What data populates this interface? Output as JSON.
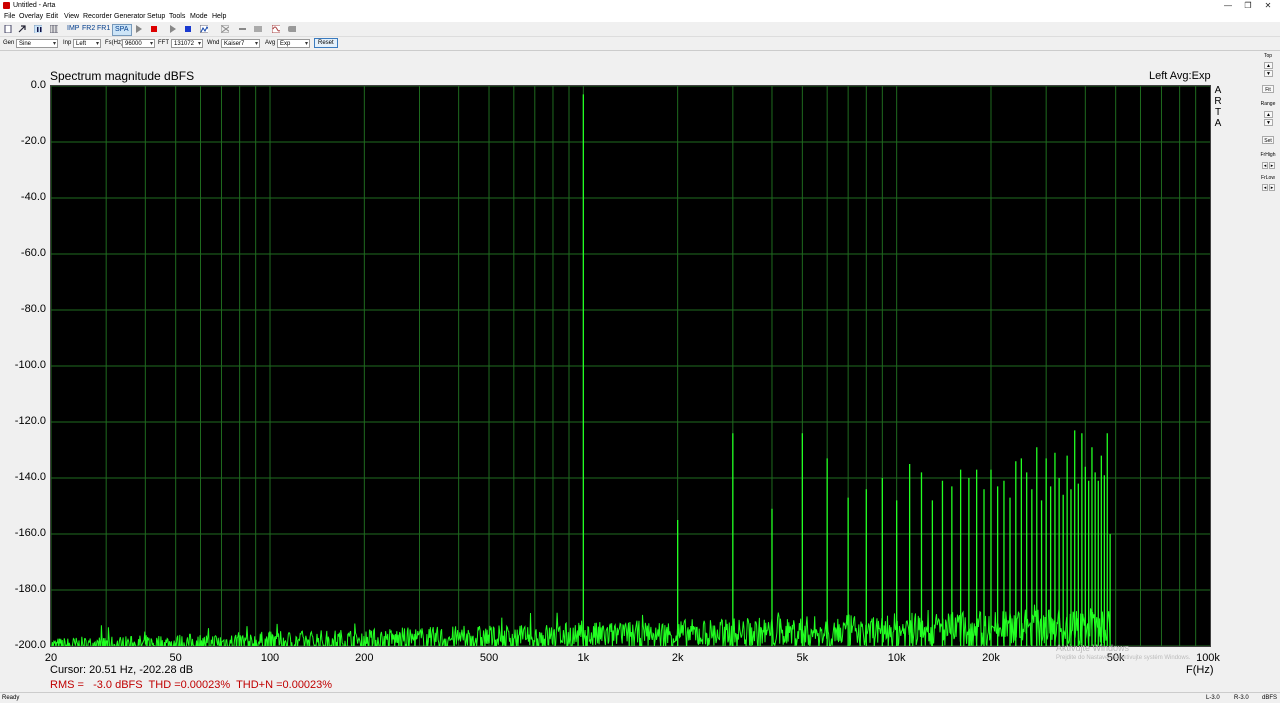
{
  "window": {
    "title": "Untitled - Arta",
    "controls": [
      "—",
      "❐",
      "✕"
    ]
  },
  "menu": [
    "File",
    "Overlay",
    "Edit",
    "View",
    "Recorder",
    "Generator",
    "Setup",
    "Tools",
    "Mode",
    "Help"
  ],
  "toolbar": {
    "mode_buttons": [
      "IMP",
      "FR2",
      "FR1",
      "SPA"
    ],
    "active_mode": "SPA"
  },
  "controls": {
    "gen_label": "Gen",
    "gen_value": "Sine",
    "inp_label": "Inp",
    "inp_value": "Left",
    "fs_label": "Fs(Hz)",
    "fs_value": "96000",
    "fft_label": "FFT",
    "fft_value": "131072",
    "wnd_label": "Wnd",
    "wnd_value": "Kaiser7",
    "avg_label": "Avg",
    "avg_value": "Exp",
    "reset_label": "Reset"
  },
  "chart_data": {
    "type": "line",
    "title": "Spectrum magnitude dBFS",
    "channel_info": "Left  Avg:Exp",
    "watermark_side": [
      "A",
      "R",
      "T",
      "A"
    ],
    "xlabel": "F(Hz)",
    "x_scale": "log",
    "xlim": [
      20,
      100000
    ],
    "ylim": [
      -200,
      0
    ],
    "y_ticks": [
      "0.0",
      "-20.0",
      "-40.0",
      "-60.0",
      "-80.0",
      "-100.0",
      "-120.0",
      "-140.0",
      "-160.0",
      "-180.0",
      "-200.0"
    ],
    "x_ticks": [
      {
        "f": 20,
        "label": "20"
      },
      {
        "f": 50,
        "label": "50"
      },
      {
        "f": 100,
        "label": "100"
      },
      {
        "f": 200,
        "label": "200"
      },
      {
        "f": 500,
        "label": "500"
      },
      {
        "f": 1000,
        "label": "1k"
      },
      {
        "f": 2000,
        "label": "2k"
      },
      {
        "f": 5000,
        "label": "5k"
      },
      {
        "f": 10000,
        "label": "10k"
      },
      {
        "f": 20000,
        "label": "20k"
      },
      {
        "f": 50000,
        "label": "50k"
      },
      {
        "f": 100000,
        "label": "100k"
      }
    ],
    "grid": true,
    "line_color": "#22ff22",
    "grid_color": "#1f6b1f",
    "background": "#000000",
    "noise_floor_db": -195,
    "noise_end_hz": 48000,
    "series": [
      {
        "peaks": [
          {
            "f": 1000,
            "db": -3.0
          },
          {
            "f": 2000,
            "db": -155
          },
          {
            "f": 3000,
            "db": -124
          },
          {
            "f": 4000,
            "db": -151
          },
          {
            "f": 5000,
            "db": -124
          },
          {
            "f": 6000,
            "db": -133
          },
          {
            "f": 7000,
            "db": -147
          },
          {
            "f": 8000,
            "db": -144
          },
          {
            "f": 9000,
            "db": -140
          },
          {
            "f": 10000,
            "db": -148
          },
          {
            "f": 11000,
            "db": -135
          },
          {
            "f": 12000,
            "db": -138
          },
          {
            "f": 13000,
            "db": -148
          },
          {
            "f": 14000,
            "db": -141
          },
          {
            "f": 15000,
            "db": -143
          },
          {
            "f": 16000,
            "db": -137
          },
          {
            "f": 17000,
            "db": -140
          },
          {
            "f": 18000,
            "db": -137
          },
          {
            "f": 19000,
            "db": -144
          },
          {
            "f": 20000,
            "db": -137
          },
          {
            "f": 21000,
            "db": -143
          },
          {
            "f": 22000,
            "db": -141
          },
          {
            "f": 23000,
            "db": -147
          },
          {
            "f": 24000,
            "db": -134
          },
          {
            "f": 25000,
            "db": -133
          },
          {
            "f": 26000,
            "db": -138
          },
          {
            "f": 27000,
            "db": -144
          },
          {
            "f": 28000,
            "db": -129
          },
          {
            "f": 29000,
            "db": -148
          },
          {
            "f": 30000,
            "db": -133
          },
          {
            "f": 31000,
            "db": -143
          },
          {
            "f": 32000,
            "db": -131
          },
          {
            "f": 33000,
            "db": -140
          },
          {
            "f": 34000,
            "db": -146
          },
          {
            "f": 35000,
            "db": -132
          },
          {
            "f": 36000,
            "db": -144
          },
          {
            "f": 37000,
            "db": -123
          },
          {
            "f": 38000,
            "db": -142
          },
          {
            "f": 39000,
            "db": -124
          },
          {
            "f": 40000,
            "db": -136
          },
          {
            "f": 41000,
            "db": -141
          },
          {
            "f": 42000,
            "db": -129
          },
          {
            "f": 43000,
            "db": -138
          },
          {
            "f": 44000,
            "db": -141
          },
          {
            "f": 45000,
            "db": -132
          },
          {
            "f": 46000,
            "db": -139
          },
          {
            "f": 47000,
            "db": -124
          },
          {
            "f": 48000,
            "db": -160
          }
        ]
      }
    ]
  },
  "readout": {
    "cursor": "Cursor: 20.51 Hz, -202.28 dB",
    "stats": "RMS =   -3.0 dBFS  THD =0.00023%  THD+N =0.00023%"
  },
  "windows_watermark": {
    "line1": "Aktivujte Windows",
    "line2": "Prejdite do Nastavení a aktivujte systém Windows."
  },
  "side_panel": {
    "top_label": "Top",
    "fit_label": "Fit",
    "range_label": "Range",
    "set_label": "Set",
    "frhigh_label": "FrHigh",
    "frlow_label": "FrLow",
    "up": "▲",
    "down": "▼",
    "left": "◂",
    "right": "▸"
  },
  "status": {
    "left": "Ready",
    "l_level": "L-3.0",
    "r_level": "R-3.0",
    "unit": "dBFS"
  }
}
